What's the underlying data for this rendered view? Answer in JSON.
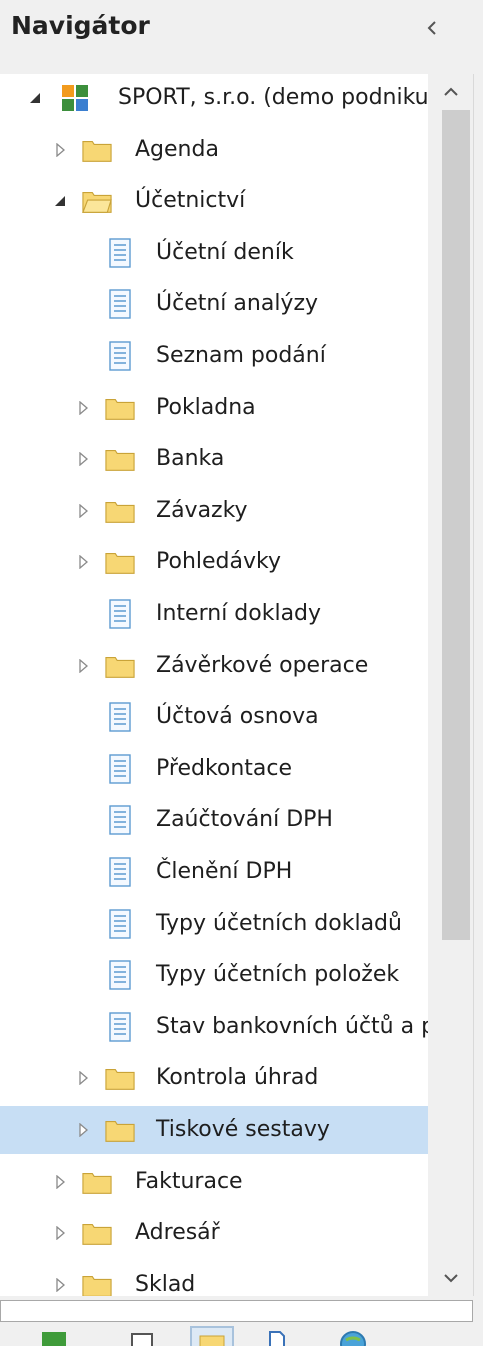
{
  "header": {
    "title": "Navigátor"
  },
  "tree": [
    {
      "label": "SPORT, s.r.o. (demo podniku)",
      "level": 0,
      "type": "root",
      "state": "expanded"
    },
    {
      "label": "Agenda",
      "level": 1,
      "type": "folder",
      "state": "collapsed"
    },
    {
      "label": "Účetnictví",
      "level": 1,
      "type": "folder",
      "state": "expanded"
    },
    {
      "label": "Účetní deník",
      "level": 2,
      "type": "doc"
    },
    {
      "label": "Účetní analýzy",
      "level": 2,
      "type": "doc"
    },
    {
      "label": "Seznam podání",
      "level": 2,
      "type": "doc"
    },
    {
      "label": "Pokladna",
      "level": 2,
      "type": "folder",
      "state": "collapsed"
    },
    {
      "label": "Banka",
      "level": 2,
      "type": "folder",
      "state": "collapsed"
    },
    {
      "label": "Závazky",
      "level": 2,
      "type": "folder",
      "state": "collapsed"
    },
    {
      "label": "Pohledávky",
      "level": 2,
      "type": "folder",
      "state": "collapsed"
    },
    {
      "label": "Interní doklady",
      "level": 2,
      "type": "doc"
    },
    {
      "label": "Závěrkové operace",
      "level": 2,
      "type": "folder",
      "state": "collapsed"
    },
    {
      "label": "Účtová osnova",
      "level": 2,
      "type": "doc"
    },
    {
      "label": "Předkontace",
      "level": 2,
      "type": "doc"
    },
    {
      "label": "Zaúčtování DPH",
      "level": 2,
      "type": "doc"
    },
    {
      "label": "Členění DPH",
      "level": 2,
      "type": "doc"
    },
    {
      "label": "Typy účetních dokladů",
      "level": 2,
      "type": "doc"
    },
    {
      "label": "Typy účetních položek",
      "level": 2,
      "type": "doc"
    },
    {
      "label": "Stav bankovních účtů a pokladen",
      "level": 2,
      "type": "doc"
    },
    {
      "label": "Kontrola úhrad",
      "level": 2,
      "type": "folder",
      "state": "collapsed"
    },
    {
      "label": "Tiskové sestavy",
      "level": 2,
      "type": "folder",
      "state": "collapsed",
      "selected": true
    },
    {
      "label": "Fakturace",
      "level": 1,
      "type": "folder",
      "state": "collapsed"
    },
    {
      "label": "Adresář",
      "level": 1,
      "type": "folder",
      "state": "collapsed"
    },
    {
      "label": "Sklad",
      "level": 1,
      "type": "folder",
      "state": "collapsed"
    }
  ],
  "icons": {
    "collapse": "chevron-left-icon",
    "scroll_up": "chevron-up-icon",
    "scroll_down": "chevron-down-icon",
    "folder": "folder-icon",
    "document": "document-icon",
    "root": "company-icon"
  },
  "colors": {
    "selection": "#c7def4",
    "folder_fill": "#f7d774",
    "folder_stroke": "#c9a338",
    "doc_stroke": "#5d9bd1"
  }
}
